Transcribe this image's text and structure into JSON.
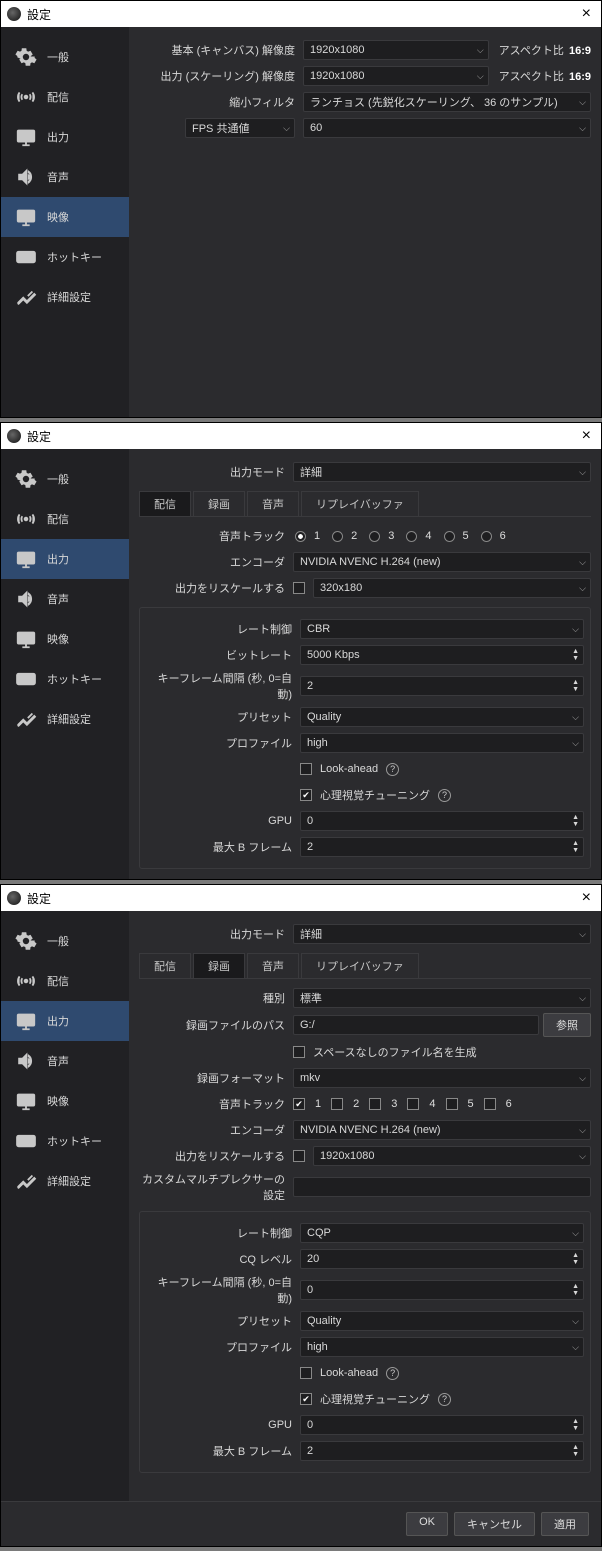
{
  "common": {
    "title": "設定",
    "sidebar": [
      {
        "id": "general",
        "label": "一般"
      },
      {
        "id": "stream",
        "label": "配信"
      },
      {
        "id": "output",
        "label": "出力"
      },
      {
        "id": "audio",
        "label": "音声"
      },
      {
        "id": "video",
        "label": "映像"
      },
      {
        "id": "hotkeys",
        "label": "ホットキー"
      },
      {
        "id": "advanced",
        "label": "詳細設定"
      }
    ],
    "ok": "OK",
    "cancel": "キャンセル",
    "apply": "適用"
  },
  "win1": {
    "base_label": "基本 (キャンバス) 解像度",
    "base_val": "1920x1080",
    "aspect1_lbl": "アスペクト比",
    "aspect1_val": "16:9",
    "out_label": "出力 (スケーリング) 解像度",
    "out_val": "1920x1080",
    "aspect2_lbl": "アスペクト比",
    "aspect2_val": "16:9",
    "filter_label": "縮小フィルタ",
    "filter_val": "ランチョス (先鋭化スケーリング、 36 のサンプル)",
    "fps_label": "FPS 共通値",
    "fps_val": "60"
  },
  "win2": {
    "mode_label": "出力モード",
    "mode_val": "詳細",
    "tabs": [
      "配信",
      "録画",
      "音声",
      "リプレイバッファ"
    ],
    "audio_track_label": "音声トラック",
    "track_selected": 1,
    "encoder_label": "エンコーダ",
    "encoder_val": "NVIDIA NVENC H.264 (new)",
    "rescale_label": "出力をリスケールする",
    "rescale_val": "320x180",
    "rate_label": "レート制御",
    "rate_val": "CBR",
    "bitrate_label": "ビットレート",
    "bitrate_val": "5000 Kbps",
    "keyframe_label": "キーフレーム間隔 (秒, 0=自動)",
    "keyframe_val": "2",
    "preset_label": "プリセット",
    "preset_val": "Quality",
    "profile_label": "プロファイル",
    "profile_val": "high",
    "lookahead": "Look-ahead",
    "psycho": "心理視覚チューニング",
    "gpu_label": "GPU",
    "gpu_val": "0",
    "bframes_label": "最大 B フレーム",
    "bframes_val": "2"
  },
  "win3": {
    "mode_label": "出力モード",
    "mode_val": "詳細",
    "tabs": [
      "配信",
      "録画",
      "音声",
      "リプレイバッファ"
    ],
    "type_label": "種別",
    "type_val": "標準",
    "path_label": "録画ファイルのパス",
    "path_val": "G:/",
    "browse": "参照",
    "nospace": "スペースなしのファイル名を生成",
    "format_label": "録画フォーマット",
    "format_val": "mkv",
    "audio_track_label": "音声トラック",
    "encoder_label": "エンコーダ",
    "encoder_val": "NVIDIA NVENC H.264 (new)",
    "rescale_label": "出力をリスケールする",
    "rescale_val": "1920x1080",
    "mux_label": "カスタムマルチプレクサーの設定",
    "rate_label": "レート制御",
    "rate_val": "CQP",
    "cq_label": "CQ レベル",
    "cq_val": "20",
    "keyframe_label": "キーフレーム間隔 (秒, 0=自動)",
    "keyframe_val": "0",
    "preset_label": "プリセット",
    "preset_val": "Quality",
    "profile_label": "プロファイル",
    "profile_val": "high",
    "lookahead": "Look-ahead",
    "psycho": "心理視覚チューニング",
    "gpu_label": "GPU",
    "gpu_val": "0",
    "bframes_label": "最大 B フレーム",
    "bframes_val": "2"
  }
}
